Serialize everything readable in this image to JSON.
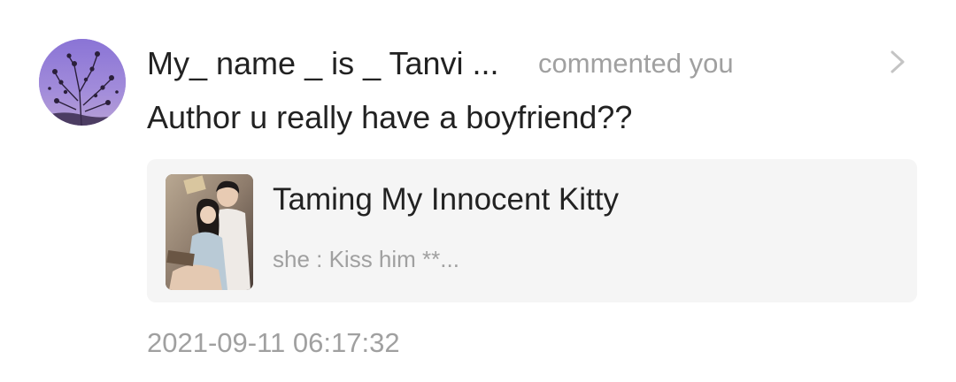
{
  "notification": {
    "username": "My_ name _ is _ Tanvi ...",
    "action": "commented you",
    "comment": "Author u really have a boyfriend??",
    "timestamp": "2021-09-11 06:17:32",
    "avatar_icon": "user-avatar-purple-sky-flowers",
    "chevron_icon": "chevron-right-icon"
  },
  "book": {
    "title": "Taming My Innocent Kitty",
    "snippet": "she : Kiss him **...",
    "cover_icon": "book-cover-couple-illustration"
  },
  "colors": {
    "primary_text": "#222222",
    "secondary_text": "#a0a0a0",
    "card_background": "#f5f5f5",
    "avatar_tint": "#9d86d9"
  }
}
